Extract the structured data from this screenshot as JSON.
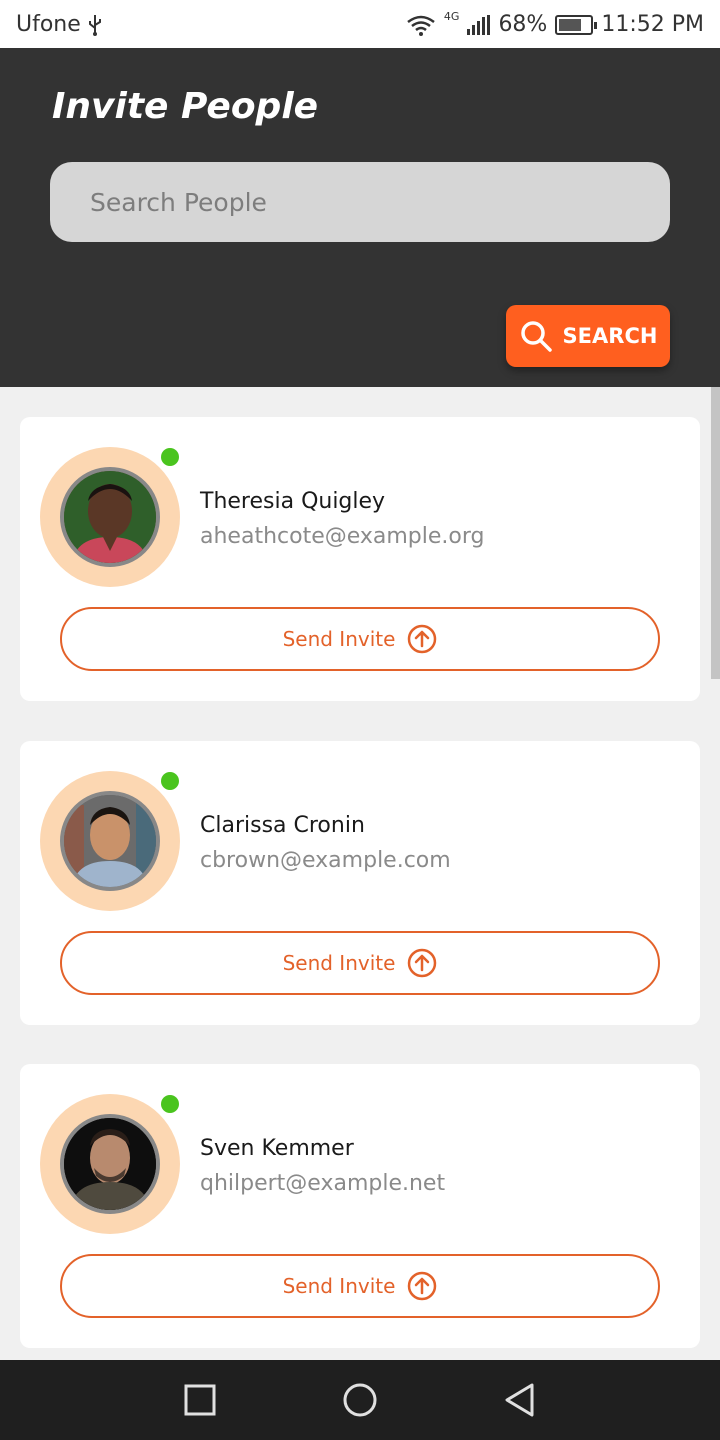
{
  "status_bar": {
    "carrier": "Ufone",
    "network": "4G",
    "battery": "68%",
    "time": "11:52 PM"
  },
  "header": {
    "title": "Invite People",
    "search_placeholder": "Search People",
    "search_button": "SEARCH"
  },
  "people": [
    {
      "name": "Theresia Quigley",
      "email": "aheathcote@example.org",
      "online": true,
      "invite_label": "Send Invite"
    },
    {
      "name": "Clarissa Cronin",
      "email": "cbrown@example.com",
      "online": true,
      "invite_label": "Send Invite"
    },
    {
      "name": "Sven Kemmer",
      "email": "qhilpert@example.net",
      "online": true,
      "invite_label": "Send Invite"
    }
  ],
  "colors": {
    "accent": "#ff5f1f",
    "header_bg": "#333333",
    "online": "#4ac41e",
    "avatar_ring": "#fcd7b2"
  }
}
